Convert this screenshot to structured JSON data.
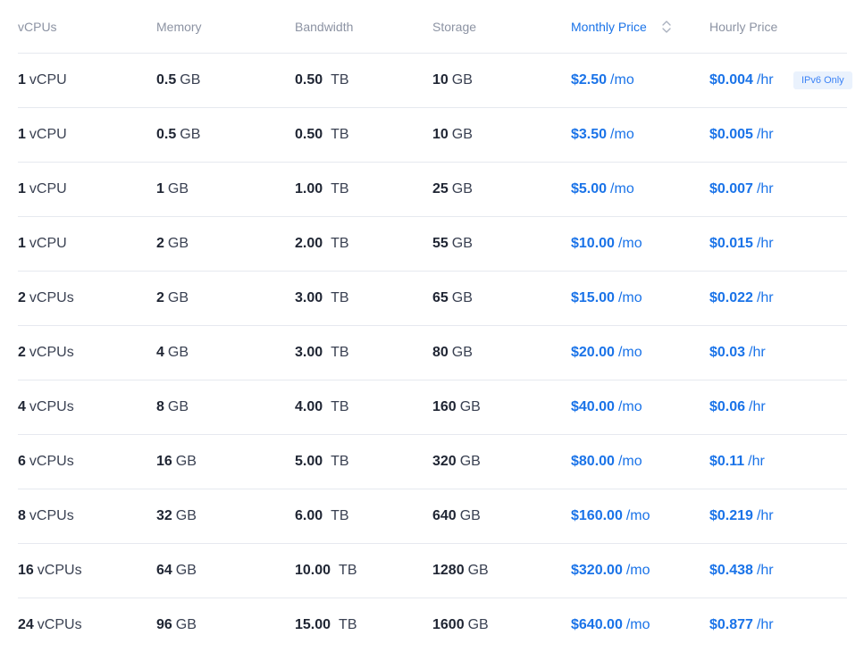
{
  "header": {
    "vcpus": "vCPUs",
    "memory": "Memory",
    "bandwidth": "Bandwidth",
    "storage": "Storage",
    "monthly_price": "Monthly Price",
    "hourly_price": "Hourly Price"
  },
  "colors": {
    "accent": "#1a73e8",
    "header_text": "#8c93a3",
    "divider": "#e6e9ef",
    "badge_bg": "#eaf2fd"
  },
  "icons": {
    "sort": "sort-updown-icon"
  },
  "rows": [
    {
      "vcpu_num": "1",
      "vcpu_unit": "vCPU",
      "mem_num": "0.5",
      "mem_unit": "GB",
      "bw_num": "0.50",
      "bw_unit": "TB",
      "storage_num": "10",
      "storage_unit": "GB",
      "monthly_num": "$2.50",
      "monthly_unit": "/mo",
      "hourly_num": "$0.004",
      "hourly_unit": "/hr",
      "badge": "IPv6 Only"
    },
    {
      "vcpu_num": "1",
      "vcpu_unit": "vCPU",
      "mem_num": "0.5",
      "mem_unit": "GB",
      "bw_num": "0.50",
      "bw_unit": "TB",
      "storage_num": "10",
      "storage_unit": "GB",
      "monthly_num": "$3.50",
      "monthly_unit": "/mo",
      "hourly_num": "$0.005",
      "hourly_unit": "/hr"
    },
    {
      "vcpu_num": "1",
      "vcpu_unit": "vCPU",
      "mem_num": "1",
      "mem_unit": "GB",
      "bw_num": "1.00",
      "bw_unit": "TB",
      "storage_num": "25",
      "storage_unit": "GB",
      "monthly_num": "$5.00",
      "monthly_unit": "/mo",
      "hourly_num": "$0.007",
      "hourly_unit": "/hr"
    },
    {
      "vcpu_num": "1",
      "vcpu_unit": "vCPU",
      "mem_num": "2",
      "mem_unit": "GB",
      "bw_num": "2.00",
      "bw_unit": "TB",
      "storage_num": "55",
      "storage_unit": "GB",
      "monthly_num": "$10.00",
      "monthly_unit": "/mo",
      "hourly_num": "$0.015",
      "hourly_unit": "/hr"
    },
    {
      "vcpu_num": "2",
      "vcpu_unit": "vCPUs",
      "mem_num": "2",
      "mem_unit": "GB",
      "bw_num": "3.00",
      "bw_unit": "TB",
      "storage_num": "65",
      "storage_unit": "GB",
      "monthly_num": "$15.00",
      "monthly_unit": "/mo",
      "hourly_num": "$0.022",
      "hourly_unit": "/hr"
    },
    {
      "vcpu_num": "2",
      "vcpu_unit": "vCPUs",
      "mem_num": "4",
      "mem_unit": "GB",
      "bw_num": "3.00",
      "bw_unit": "TB",
      "storage_num": "80",
      "storage_unit": "GB",
      "monthly_num": "$20.00",
      "monthly_unit": "/mo",
      "hourly_num": "$0.03",
      "hourly_unit": "/hr"
    },
    {
      "vcpu_num": "4",
      "vcpu_unit": "vCPUs",
      "mem_num": "8",
      "mem_unit": "GB",
      "bw_num": "4.00",
      "bw_unit": "TB",
      "storage_num": "160",
      "storage_unit": "GB",
      "monthly_num": "$40.00",
      "monthly_unit": "/mo",
      "hourly_num": "$0.06",
      "hourly_unit": "/hr"
    },
    {
      "vcpu_num": "6",
      "vcpu_unit": "vCPUs",
      "mem_num": "16",
      "mem_unit": "GB",
      "bw_num": "5.00",
      "bw_unit": "TB",
      "storage_num": "320",
      "storage_unit": "GB",
      "monthly_num": "$80.00",
      "monthly_unit": "/mo",
      "hourly_num": "$0.11",
      "hourly_unit": "/hr"
    },
    {
      "vcpu_num": "8",
      "vcpu_unit": "vCPUs",
      "mem_num": "32",
      "mem_unit": "GB",
      "bw_num": "6.00",
      "bw_unit": "TB",
      "storage_num": "640",
      "storage_unit": "GB",
      "monthly_num": "$160.00",
      "monthly_unit": "/mo",
      "hourly_num": "$0.219",
      "hourly_unit": "/hr"
    },
    {
      "vcpu_num": "16",
      "vcpu_unit": "vCPUs",
      "mem_num": "64",
      "mem_unit": "GB",
      "bw_num": "10.00",
      "bw_unit": "TB",
      "storage_num": "1280",
      "storage_unit": "GB",
      "monthly_num": "$320.00",
      "monthly_unit": "/mo",
      "hourly_num": "$0.438",
      "hourly_unit": "/hr"
    },
    {
      "vcpu_num": "24",
      "vcpu_unit": "vCPUs",
      "mem_num": "96",
      "mem_unit": "GB",
      "bw_num": "15.00",
      "bw_unit": "TB",
      "storage_num": "1600",
      "storage_unit": "GB",
      "monthly_num": "$640.00",
      "monthly_unit": "/mo",
      "hourly_num": "$0.877",
      "hourly_unit": "/hr"
    }
  ]
}
